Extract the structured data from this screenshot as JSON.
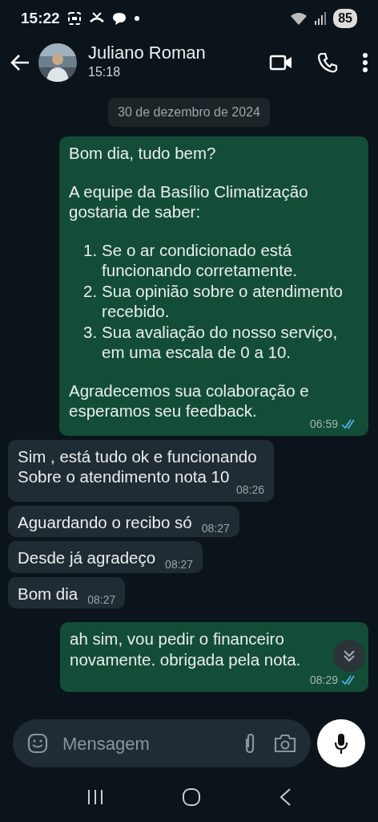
{
  "status_bar": {
    "time": "15:22",
    "battery": "85"
  },
  "header": {
    "contact_name": "Juliano Roman",
    "last_seen": "15:18"
  },
  "date_chip": "30 de dezembro de 2024",
  "messages": [
    {
      "kind": "outgoing",
      "time": "06:59",
      "read": true,
      "blocks": [
        {
          "kind": "text",
          "text": "Bom dia, tudo bem?"
        },
        {
          "kind": "text",
          "text": "A equipe da Basílio Climatização gostaria de saber:"
        },
        {
          "kind": "list",
          "items": [
            {
              "number": "1.",
              "text": "Se o ar condicionado está funcionando corretamente."
            },
            {
              "number": "2.",
              "text": "Sua opinião sobre o atendimento recebido."
            },
            {
              "number": "3.",
              "text": "Sua avaliação do nosso serviço, em uma escala de 0 a 10."
            }
          ]
        },
        {
          "kind": "text",
          "text": "Agradecemos sua colaboração e esperamos seu feedback."
        }
      ]
    },
    {
      "kind": "incoming",
      "time": "08:26",
      "blocks": [
        {
          "kind": "text",
          "text": "Sim , está tudo ok e funcionando Sobre o atendimento nota 10"
        }
      ]
    },
    {
      "kind": "incoming",
      "time": "08:27",
      "blocks": [
        {
          "kind": "text",
          "text": "Aguardando o recibo só"
        }
      ]
    },
    {
      "kind": "incoming",
      "time": "08:27",
      "blocks": [
        {
          "kind": "text",
          "text": "Desde já agradeço"
        }
      ]
    },
    {
      "kind": "incoming",
      "time": "08:27",
      "blocks": [
        {
          "kind": "text",
          "text": "Bom dia"
        }
      ]
    },
    {
      "kind": "outgoing",
      "time": "08:29",
      "read": true,
      "blocks": [
        {
          "kind": "text",
          "text": "ah sim, vou pedir o financeiro novamente. obrigada pela nota."
        }
      ]
    }
  ],
  "composer": {
    "placeholder": "Mensagem"
  }
}
